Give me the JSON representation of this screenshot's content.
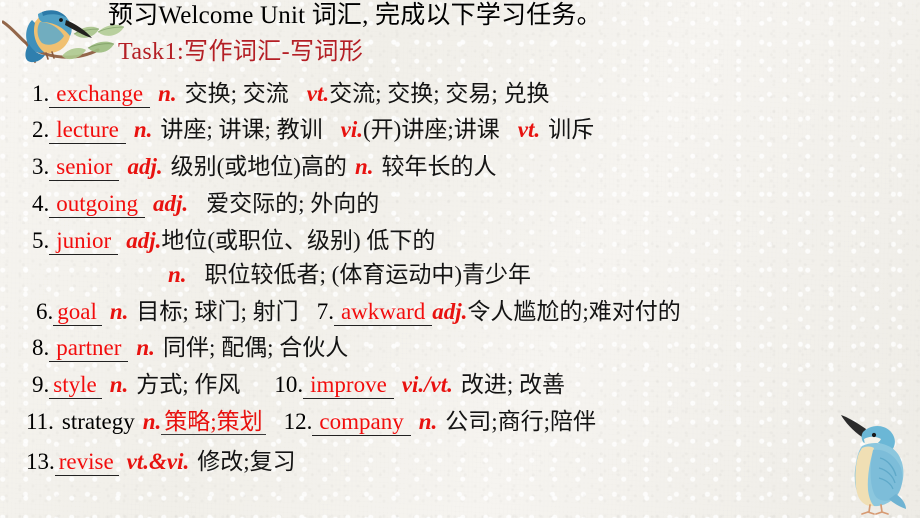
{
  "slide": {
    "title": "预习Welcome Unit 词汇, 完成以下学习任务。",
    "task_heading": "Task1:写作词汇-写词形",
    "colors": {
      "answer_red": "#f20d0d",
      "pos_red": "#e8120f",
      "heading_red": "#b41f25",
      "body_black": "#000000",
      "paper": "#f5f3ef"
    }
  },
  "items": [
    {
      "num": "1.",
      "answer": "exchange",
      "pos1": "n.",
      "gloss1": "交换; 交流",
      "pos2": "vt.",
      "gloss2": "交流; 交换; 交易; 兑换"
    },
    {
      "num": "2.",
      "answer": "lecture",
      "pos1": "n.",
      "gloss1": "讲座; 讲课; 教训",
      "pos2": "vi.",
      "gloss2": "(开)讲座;讲课",
      "pos3": "vt.",
      "gloss3": "训斥"
    },
    {
      "num": "3.",
      "answer": "senior",
      "pos1": "adj.",
      "gloss1": "级别(或地位)高的",
      "pos2": "n.",
      "gloss2": "较年长的人"
    },
    {
      "num": "4.",
      "answer": "outgoing",
      "pos1": "adj.",
      "gloss1": "爱交际的; 外向的"
    },
    {
      "num": "5.",
      "answer": "junior",
      "pos1": "adj.",
      "gloss1": "地位(或职位、级别) 低下的",
      "pos2": "n.",
      "gloss2": "职位较低者; (体育运动中)青少年"
    },
    {
      "num": "6.",
      "answer": "goal",
      "pos1": "n.",
      "gloss1": "目标; 球门; 射门"
    },
    {
      "num": "7.",
      "answer": "awkward",
      "pos1": "adj.",
      "gloss1": "令人尴尬的;难对付的"
    },
    {
      "num": "8.",
      "answer": "partner",
      "pos1": "n.",
      "gloss1": "同伴; 配偶; 合伙人"
    },
    {
      "num": "9.",
      "answer": "style",
      "pos1": "n.",
      "gloss1": "方式; 作风"
    },
    {
      "num": "10.",
      "answer": "improve",
      "pos1": "vi./vt.",
      "gloss1": "改进; 改善"
    },
    {
      "num": "11.",
      "word": "strategy",
      "pos1": "n.",
      "answer_cn": "策略;策划"
    },
    {
      "num": "12.",
      "answer": "company",
      "pos1": "n.",
      "gloss1": "公司;商行;陪伴"
    },
    {
      "num": "13.",
      "answer": "revise",
      "pos1": "vt.&vi.",
      "gloss1": "修改;复习"
    }
  ],
  "decorations": [
    {
      "name": "kingfisher-on-branch",
      "position": "top-left"
    },
    {
      "name": "kingfisher-standing",
      "position": "bottom-right"
    }
  ]
}
